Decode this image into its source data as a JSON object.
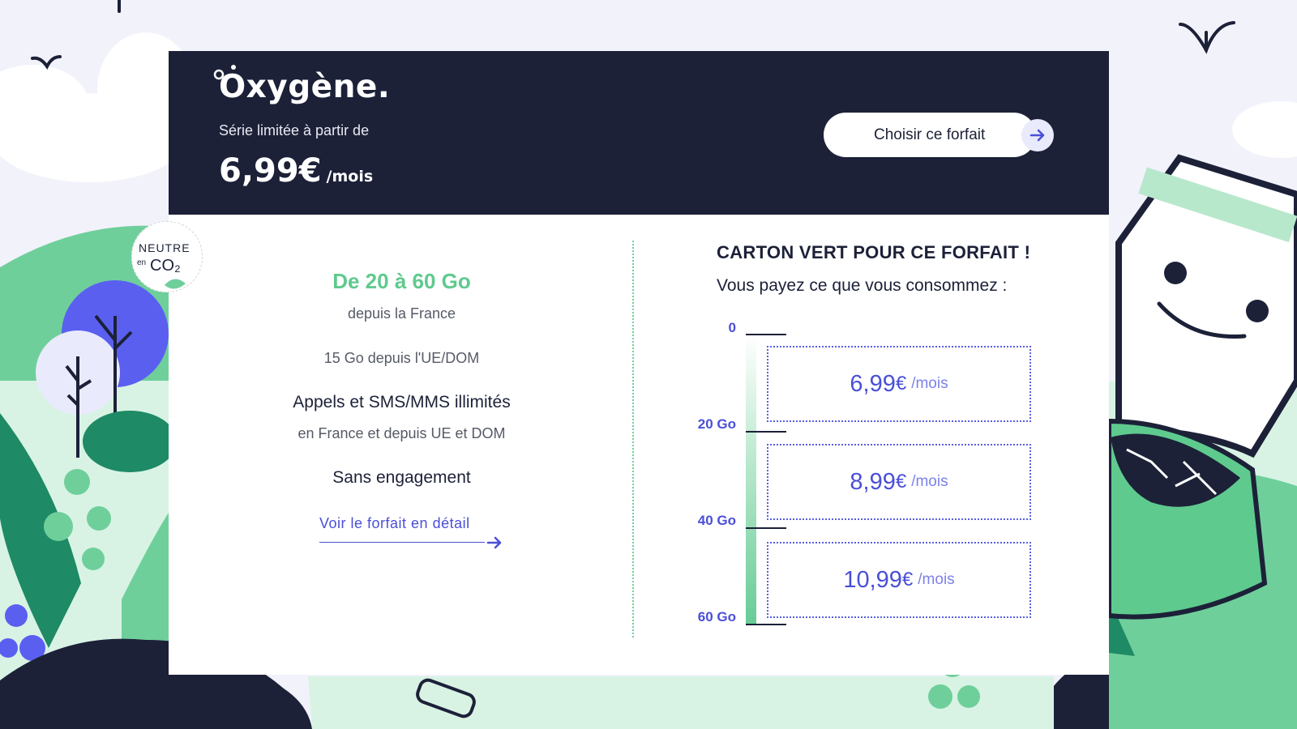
{
  "header": {
    "brand": "Oxygène.",
    "intro": "Série limitée à partir de",
    "price": "6,99€",
    "price_unit": "/mois",
    "cta_label": "Choisir ce forfait"
  },
  "badge": {
    "top": "NEUTRE",
    "en": "en",
    "co": "CO₂"
  },
  "features": {
    "data_main": "De 20 à 60 Go",
    "data_sub": "depuis la France",
    "eu_data": "15 Go depuis l'UE/DOM",
    "calls": "Appels et SMS/MMS illimités",
    "calls_sub": "en France et depuis UE et DOM",
    "commitment": "Sans engagement",
    "detail_link": "Voir le forfait en détail"
  },
  "usage": {
    "title": "CARTON VERT POUR CE FORFAIT !",
    "subtitle": "Vous payez ce que vous consommez :",
    "scale": [
      "0",
      "20 Go",
      "40 Go",
      "60 Go"
    ],
    "tiers": [
      {
        "amount": "6,99",
        "currency": "€",
        "period": "/mois"
      },
      {
        "amount": "8,99",
        "currency": "€",
        "period": "/mois"
      },
      {
        "amount": "10,99",
        "currency": "€",
        "period": "/mois"
      }
    ]
  },
  "colors": {
    "navy": "#1c2138",
    "green": "#5fca8e",
    "accent": "#4a4fd8"
  },
  "icons": [
    "arrow-right-icon",
    "leaf-icon",
    "bird-icon",
    "smiling-bag-icon"
  ]
}
